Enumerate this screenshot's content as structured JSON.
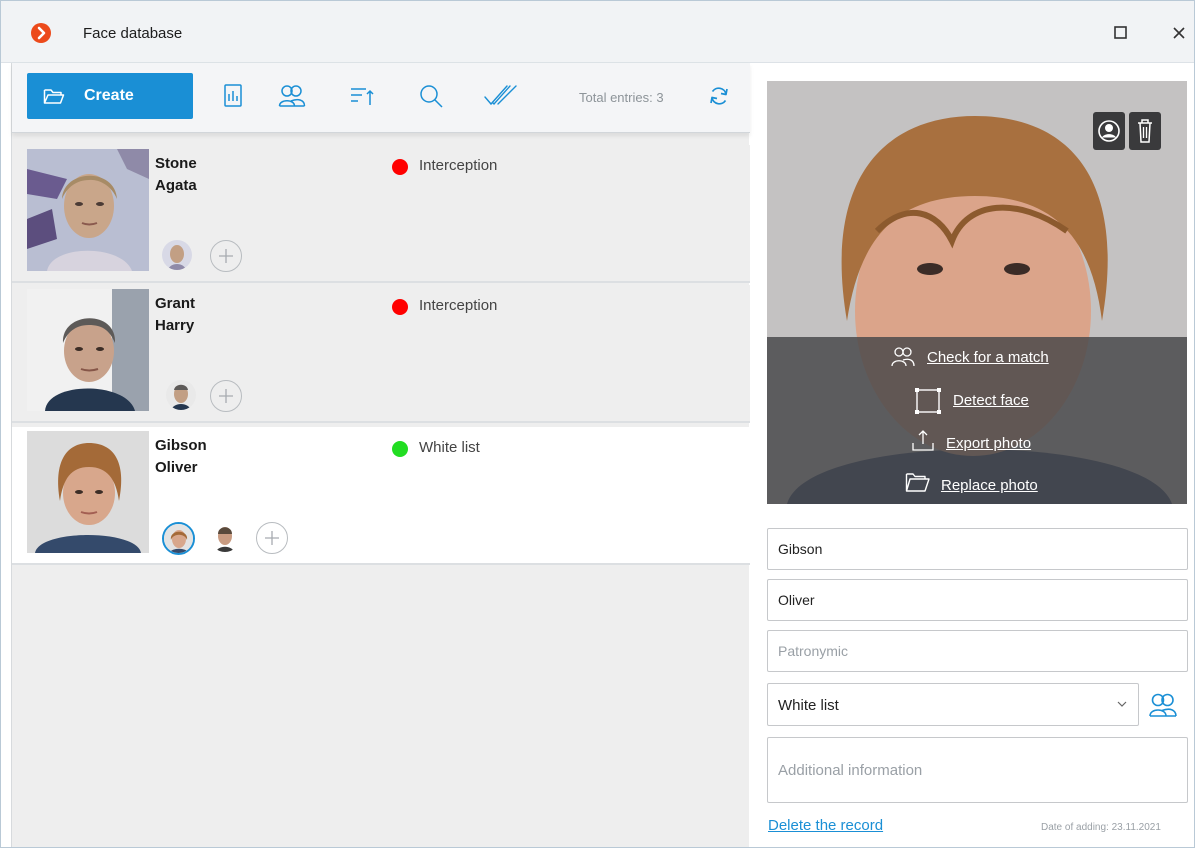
{
  "window": {
    "title": "Face database",
    "maximize_icon": "square-maximize-icon",
    "close_icon": "close-x-icon"
  },
  "toolbar": {
    "create_label": "Create",
    "create_icon": "folder-open-icon",
    "icons": [
      "report-icon",
      "groups-icon",
      "sort-icon",
      "search-icon",
      "check-all-icon"
    ],
    "total_entries": "Total entries: 3",
    "refresh_icon": "refresh-icon",
    "accent_color": "#1a8fd5"
  },
  "list": [
    {
      "surname": "Stone",
      "first_name": "Agata",
      "status": "Interception",
      "status_color": "#ff0000",
      "selected": false
    },
    {
      "surname": "Grant",
      "first_name": "Harry",
      "status": "Interception",
      "status_color": "#ff0000",
      "selected": false
    },
    {
      "surname": "Gibson",
      "first_name": "Oliver",
      "status": "White list",
      "status_color": "#22dd22",
      "selected": true
    }
  ],
  "details": {
    "photo_actions": {
      "check_match": "Check for a match",
      "detect_face": "Detect face",
      "export_photo": "Export photo",
      "replace_photo": "Replace photo"
    },
    "surname_value": "Gibson",
    "first_name_value": "Oliver",
    "patronymic_placeholder": "Patronymic",
    "list_select_value": "White list",
    "additional_info_placeholder": "Additional information",
    "delete_label": "Delete the record",
    "date_added": "Date of adding: 23.11.2021"
  }
}
